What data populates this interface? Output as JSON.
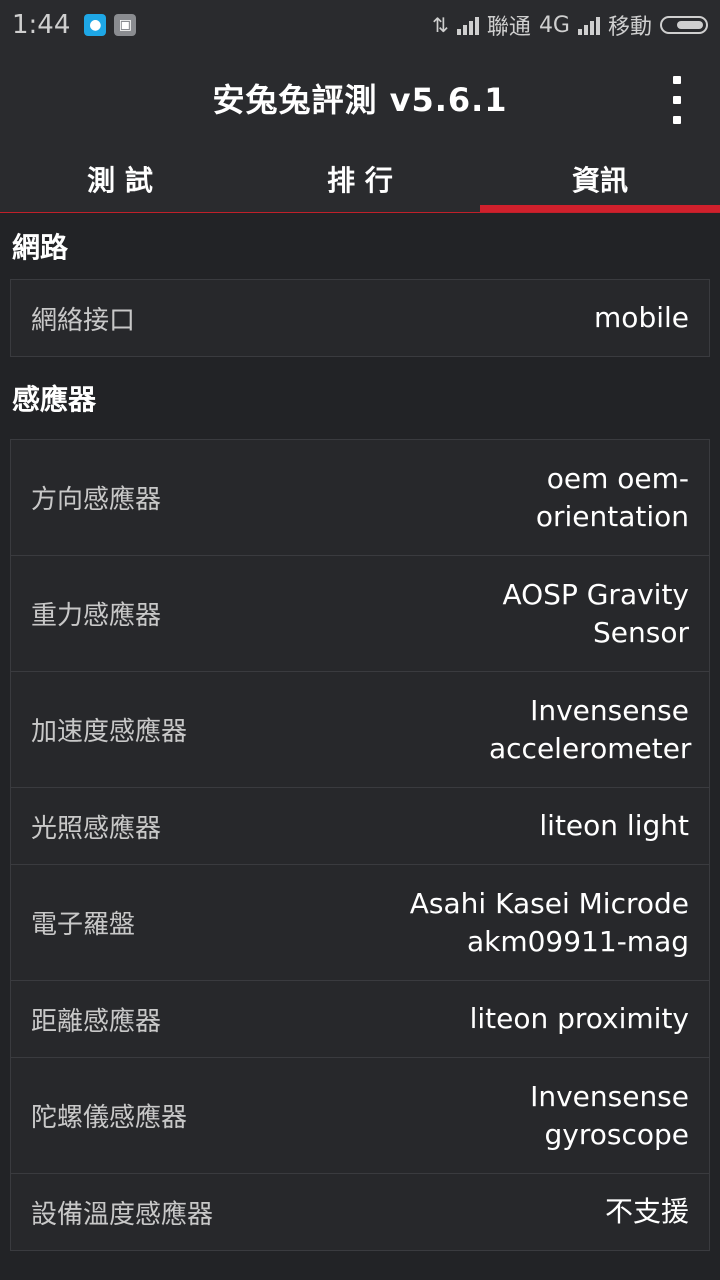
{
  "status_bar": {
    "time": "1:44",
    "carrier1": "聯通",
    "network": "4G",
    "carrier2": "移動"
  },
  "app_bar": {
    "title": "安兔兔評測 v5.6.1"
  },
  "tabs": [
    {
      "label": "測 試"
    },
    {
      "label": "排 行"
    },
    {
      "label": "資訊"
    }
  ],
  "network_section": {
    "title": "網路",
    "rows": [
      {
        "label": "網絡接口",
        "value": "mobile"
      }
    ]
  },
  "sensor_section": {
    "title": "感應器",
    "rows": [
      {
        "label": "方向感應器",
        "value": "oem oem-orientation"
      },
      {
        "label": "重力感應器",
        "value": "AOSP Gravity Sensor"
      },
      {
        "label": "加速度感應器",
        "value": "Invensense accelerometer"
      },
      {
        "label": "光照感應器",
        "value": "liteon light"
      },
      {
        "label": "電子羅盤",
        "value": "Asahi Kasei Microde akm09911-mag"
      },
      {
        "label": "距離感應器",
        "value": "liteon proximity"
      },
      {
        "label": "陀螺儀感應器",
        "value": "Invensense gyroscope"
      },
      {
        "label": "設備溫度感應器",
        "value": "不支援"
      }
    ]
  },
  "colors": {
    "background": "#222326",
    "accent": "#d0202c"
  }
}
